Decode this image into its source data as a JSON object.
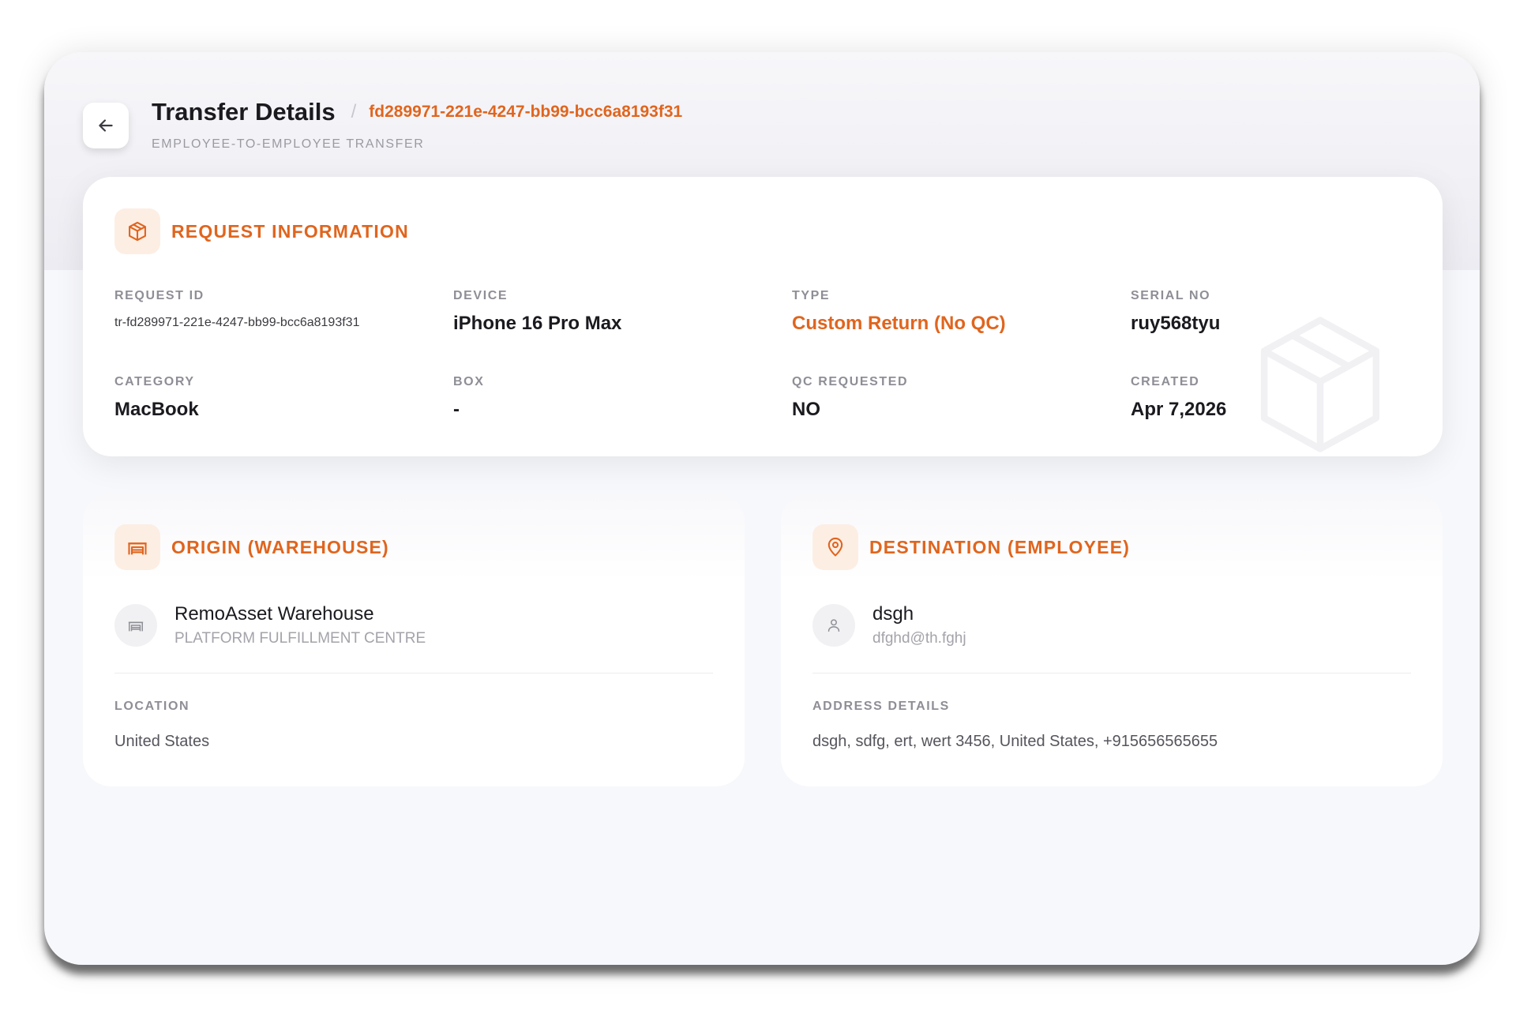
{
  "header": {
    "title": "Transfer Details",
    "separator": "/",
    "transfer_id": "fd289971-221e-4247-bb99-bcc6a8193f31",
    "subtitle": "EMPLOYEE-TO-EMPLOYEE TRANSFER"
  },
  "request": {
    "title": "REQUEST INFORMATION",
    "fields": [
      {
        "label": "REQUEST ID",
        "value": "tr-fd289971-221e-4247-bb99-bcc6a8193f31"
      },
      {
        "label": "DEVICE",
        "value": "iPhone 16 Pro Max"
      },
      {
        "label": "TYPE",
        "value": "Custom Return (No QC)"
      },
      {
        "label": "SERIAL NO",
        "value": "ruy568tyu"
      },
      {
        "label": "CATEGORY",
        "value": "MacBook"
      },
      {
        "label": "BOX",
        "value": "-"
      },
      {
        "label": "QC REQUESTED",
        "value": "NO"
      },
      {
        "label": "CREATED",
        "value": "Apr 7,2026"
      }
    ]
  },
  "origin": {
    "title": "ORIGIN (WAREHOUSE)",
    "name": "RemoAsset Warehouse",
    "sub": "PLATFORM FULFILLMENT CENTRE",
    "block_label": "LOCATION",
    "block_value": "United States"
  },
  "destination": {
    "title": "DESTINATION (EMPLOYEE)",
    "name": "dsgh",
    "sub": "dfghd@th.fghj",
    "block_label": "ADDRESS DETAILS",
    "block_value": "dsgh, sdfg, ert, wert 3456, United States, +915656565655"
  },
  "colors": {
    "accent": "#e0651e",
    "accent_bg": "#fdeee4"
  },
  "icons": [
    "arrow-left-icon",
    "package-icon",
    "warehouse-icon",
    "map-pin-icon",
    "user-icon"
  ]
}
